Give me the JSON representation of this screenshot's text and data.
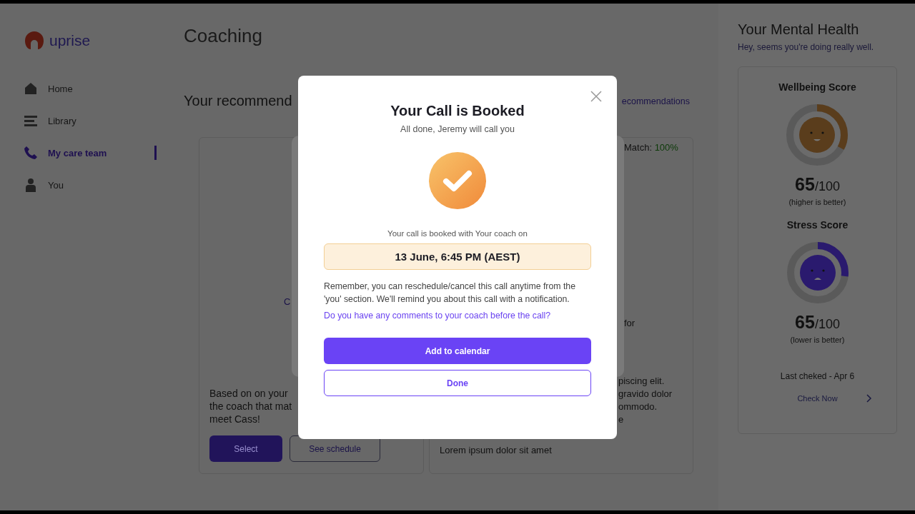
{
  "sidebar": {
    "logo": "uprise",
    "items": [
      {
        "label": "Home",
        "selected": false
      },
      {
        "label": "Library",
        "selected": false
      },
      {
        "label": "My care team",
        "selected": true
      },
      {
        "label": "You",
        "selected": false
      }
    ]
  },
  "page_title": "Coaching",
  "recommendations": {
    "heading": "Your recommend",
    "link": "ecommendations",
    "left_card": {
      "name_fragment": "C",
      "description_lines": [
        "Based on on your",
        "the coach that mat",
        "meet Cass!"
      ],
      "select_button": "Select",
      "schedule_button": "See schedule"
    },
    "right_card": {
      "match_label": "Match:",
      "match_value": "100%",
      "fragments": [
        "for",
        "piscing elit.",
        "gravido dolor",
        "ommodo.",
        "e"
      ],
      "footer": "Lorem ipsum dolor sit amet"
    }
  },
  "mental_health": {
    "title": "Your Mental Health",
    "subtitle": "Hey, seems you're doing really well.",
    "scores": [
      {
        "title": "Wellbeing Score",
        "value": "65",
        "max": "/100",
        "note": "(higher is better)",
        "level": 0.33,
        "color": "#5a3d1c"
      },
      {
        "title": "Stress Score",
        "value": "65",
        "max": "/100",
        "note": "(lower is better)",
        "level": 0.27,
        "color": "#2a1a6e"
      }
    ],
    "last_checked": "Last cheked - Apr 6",
    "check_button": "Check Now"
  },
  "modal": {
    "title": "Your Call is Booked",
    "subtitle": "All done, Jeremy will call you",
    "booked_with": "Your call is booked with Your coach on",
    "datetime": "13 June, 6:45 PM (AEST)",
    "reminder": "Remember, you can reschedule/cancel this call anytime from the 'you' section. We'll remind you about this call with a notification.",
    "comments_link": "Do you have any comments to your coach before the call?",
    "primary_button": "Add to calendar",
    "secondary_button": "Done"
  }
}
